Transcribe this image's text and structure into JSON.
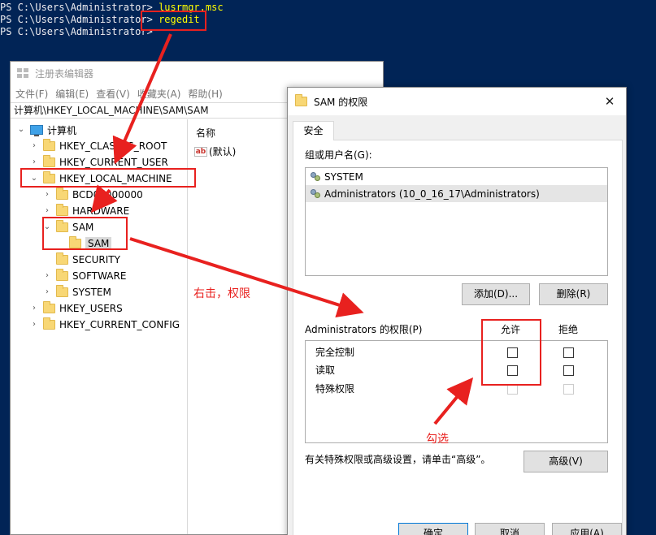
{
  "console": {
    "lines": [
      {
        "prompt": "PS C:\\Users\\Administrator> ",
        "cmd": "lusrmgr.msc"
      },
      {
        "prompt": "PS C:\\Users\\Administrator> ",
        "cmd": "regedit"
      },
      {
        "prompt": "PS C:\\Users\\Administrator> ",
        "cmd": ""
      }
    ]
  },
  "regedit": {
    "title": "注册表编辑器",
    "menu": [
      "文件(F)",
      "编辑(E)",
      "查看(V)",
      "收藏夹(A)",
      "帮助(H)"
    ],
    "address": "计算机\\HKEY_LOCAL_MACHINE\\SAM\\SAM",
    "tree": {
      "root": "计算机",
      "hkcr": "HKEY_CLASSES_ROOT",
      "hkcu": "HKEY_CURRENT_USER",
      "hklm": "HKEY_LOCAL_MACHINE",
      "bcd": "BCD00000000",
      "hardware": "HARDWARE",
      "sam": "SAM",
      "sam_child": "SAM",
      "security": "SECURITY",
      "software": "SOFTWARE",
      "system": "SYSTEM",
      "hku": "HKEY_USERS",
      "hkcc": "HKEY_CURRENT_CONFIG"
    },
    "values": {
      "header_name": "名称",
      "default_value": "(默认)",
      "icon": "ab"
    }
  },
  "dialog": {
    "title": "SAM 的权限",
    "close": "✕",
    "tab": "安全",
    "group_label": "组或用户名(G):",
    "users": [
      "SYSTEM",
      "Administrators (10_0_16_17\\Administrators)"
    ],
    "add_button": "添加(D)...",
    "remove_button": "删除(R)",
    "perm_label": "Administrators 的权限(P)",
    "allow_header": "允许",
    "deny_header": "拒绝",
    "permissions": [
      "完全控制",
      "读取",
      "特殊权限"
    ],
    "advanced_hint": "有关特殊权限或高级设置，请单击“高级”。",
    "advanced_button": "高级(V)",
    "ok_button": "确定",
    "cancel_button": "取消",
    "apply_button": "应用(A)"
  },
  "annotations": {
    "right_click": "右击，权限",
    "check": "勾选",
    "color": "#e8211f"
  }
}
